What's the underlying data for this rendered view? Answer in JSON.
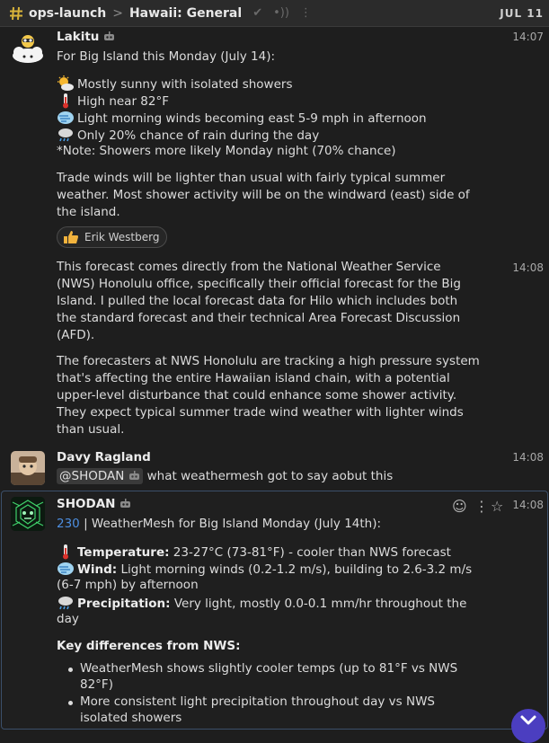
{
  "topbar": {
    "stream": "ops-launch",
    "separator": ">",
    "topic": "Hawaii: General",
    "date": "JUL 11"
  },
  "messages": {
    "lakitu": {
      "sender": "Lakitu",
      "time1": "14:07",
      "intro": "For Big Island this Monday (July 14):",
      "l1": "Mostly sunny with isolated showers",
      "l2": "High near 82°F",
      "l3": "Light morning winds becoming east 5-9 mph in afternoon",
      "l4": "Only 20% chance of rain during the day",
      "l5": "*Note: Showers more likely Monday night (70% chance)",
      "p2a": "Trade winds will be lighter than usual with fairly typical summer",
      "p2b": "weather. Most shower activity will be on the windward (east) side of",
      "p2c": "the island.",
      "reaction_user": "Erik Westberg",
      "time2": "14:08",
      "p3a": "This forecast comes directly from the National Weather Service",
      "p3b": "(NWS) Honolulu office, specifically their official forecast for the Big",
      "p3c": "Island. I pulled the local forecast data for Hilo which includes both",
      "p3d": "the standard forecast and their technical Area Forecast Discussion",
      "p3e": "(AFD).",
      "p4a": "The forecasters at NWS Honolulu are tracking a high pressure system",
      "p4b": "that's affecting the entire Hawaiian island chain, with a potential",
      "p4c": "upper-level disturbance that could enhance some shower activity.",
      "p4d": "They expect typical summer trade wind weather with lighter winds",
      "p4e": "than usual."
    },
    "davy": {
      "sender": "Davy Ragland",
      "time": "14:08",
      "mention": "@SHODAN",
      "text": "what weathermesh got to say aobut this"
    },
    "shodan": {
      "sender": "SHODAN",
      "time": "14:08",
      "link": "230",
      "title": " | WeatherMesh for Big Island Monday (July 14th):",
      "temp_label": "Temperature:",
      "temp_text": " 23-27°C (73-81°F) - cooler than NWS forecast",
      "wind_label": "Wind:",
      "wind_text": " Light morning winds (0.2-1.2 m/s), building to 2.6-3.2 m/s",
      "wind_text2": "(6-7 mph) by afternoon",
      "precip_label": "Precipitation:",
      "precip_text": " Very light, mostly 0.0-0.1 mm/hr throughout the",
      "precip_text2": "day",
      "diff_heading": "Key differences from NWS:",
      "b1a": "WeatherMesh shows slightly cooler temps (up to 81°F vs NWS",
      "b1b": "82°F)",
      "b2a": "More consistent light precipitation throughout day vs NWS",
      "b2b": "isolated showers"
    }
  },
  "icons": [
    "hash-icon",
    "check-icon",
    "mute-icon",
    "menu-dots-icon",
    "bot-icon",
    "sun-cloud-icon",
    "thermometer-icon",
    "wind-icon",
    "rain-cloud-icon",
    "thumbs-up-icon",
    "emoji-icon",
    "star-icon",
    "chevron-down-icon"
  ],
  "colors": {
    "accent": "#4b3ec0",
    "link": "#4d8ee0",
    "focus_border": "#3b4f6a"
  }
}
